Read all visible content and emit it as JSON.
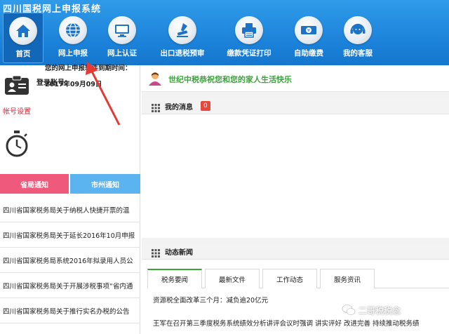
{
  "header": {
    "title": "四川国税网上申报系统"
  },
  "nav": [
    {
      "label": "首页",
      "icon": "home-icon"
    },
    {
      "label": "网上申报",
      "icon": "globe-icon"
    },
    {
      "label": "网上认证",
      "icon": "monitor-icon"
    },
    {
      "label": "出口退税预审",
      "icon": "stamp-icon"
    },
    {
      "label": "缴款凭证打印",
      "icon": "printer-icon"
    },
    {
      "label": "自助缴费",
      "icon": "cash-icon"
    },
    {
      "label": "我的客服",
      "icon": "support-icon"
    }
  ],
  "account": {
    "login_label": "登录账号：",
    "settings_link": "帐号设置",
    "expire_label": "您的网上申报软件到期时间：",
    "expire_date": "2017年09月09日"
  },
  "notices": {
    "tabs": [
      "省局通知",
      "市州通知"
    ],
    "items": [
      "四川省国家税务局关于纳税人快捷开票的温",
      "四川省国家税务局关于延长2016年10月申报",
      "四川省国家税务局系统2016年拟录用人员公",
      "四川省国家税务局关于开展涉税事项“省内通",
      "四川省国家税务局关于推行实名办税的公告"
    ]
  },
  "welcome": {
    "text": "世纪中税恭祝您和您的家人生活快乐"
  },
  "messages": {
    "title": "我的消息",
    "count": "0"
  },
  "news": {
    "title": "动态新闻",
    "tabs": [
      "税务要闻",
      "最新文件",
      "工作动态",
      "服务资讯"
    ],
    "items": [
      "资源税全面改革三个月：减负逾20亿元",
      "王军在召开第三季度税务系统绩效分析讲评会议时强调 讲实评好   改进完善 持续推动税务绩"
    ]
  },
  "watermark": {
    "text": "二哥税税念"
  },
  "colors": {
    "header": "#1a80d8",
    "province_tab": "#ef5a7c",
    "city_tab": "#5bb3ef",
    "welcome": "#3aa33a",
    "badge": "#e8473a",
    "arrow": "#e53935"
  }
}
